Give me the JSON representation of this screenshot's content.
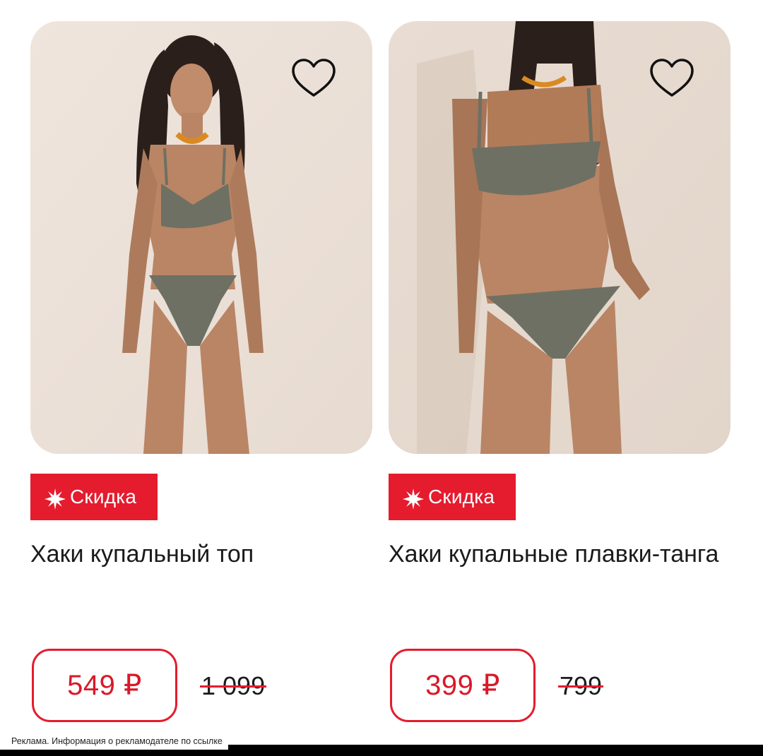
{
  "products": [
    {
      "badge": "Скидка",
      "title": "Хаки купальный топ",
      "price": "549 ₽",
      "old_price": "1 099"
    },
    {
      "badge": "Скидка",
      "title": "Хаки купальные плавки-танга",
      "price": "399 ₽",
      "old_price": "799"
    }
  ],
  "ad_notice": "Реклама. Информация о рекламодателе по ссылке",
  "colors": {
    "accent": "#e51b2e",
    "price": "#d8192a",
    "photo_bg": "#ece2da",
    "swimsuit": "#6e7063",
    "skin": "#b98565",
    "hair": "#2a1f1a"
  },
  "icons": {
    "favorite": "heart-outline-icon",
    "badge": "burst-star-icon"
  }
}
